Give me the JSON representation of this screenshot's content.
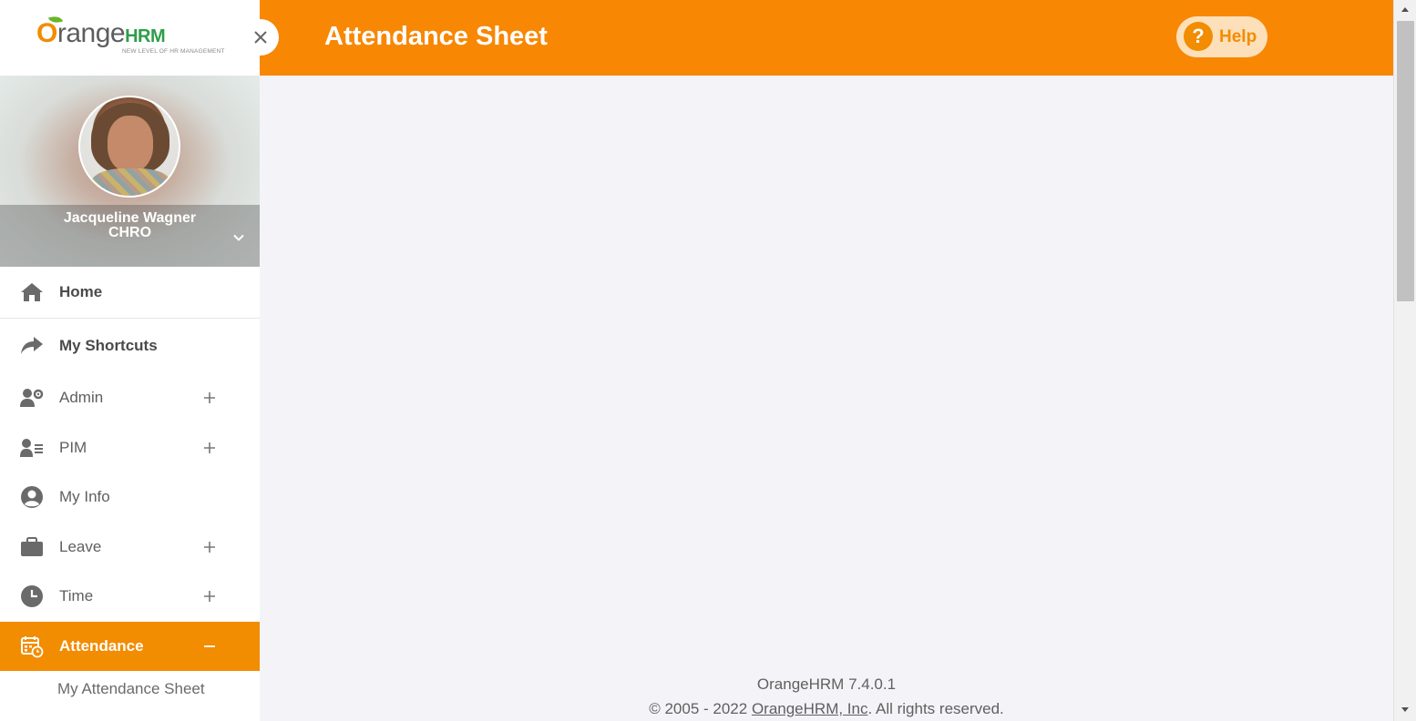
{
  "app": {
    "brand": "OrangeHRM",
    "tagline": "NEW LEVEL OF HR MANAGEMENT"
  },
  "profile": {
    "name": "Jacqueline Wagner",
    "role": "CHRO"
  },
  "menu": {
    "home": "Home",
    "shortcuts": "My Shortcuts",
    "items": [
      {
        "label": "Admin",
        "icon": "user-gear-icon",
        "expandable": true
      },
      {
        "label": "PIM",
        "icon": "user-list-icon",
        "expandable": true
      },
      {
        "label": "My Info",
        "icon": "user-circle-icon",
        "expandable": false
      },
      {
        "label": "Leave",
        "icon": "briefcase-icon",
        "expandable": true
      },
      {
        "label": "Time",
        "icon": "clock-icon",
        "expandable": true
      },
      {
        "label": "Attendance",
        "icon": "calendar-clock-icon",
        "expanded": true
      }
    ],
    "submenu": [
      "My Attendance Sheet"
    ]
  },
  "header": {
    "title": "Attendance Sheet",
    "help_label": "Help",
    "help_icon": "?"
  },
  "footer": {
    "version": "OrangeHRM 7.4.0.1",
    "copyright_prefix": "© 2005 - 2022 ",
    "company_link": "OrangeHRM, Inc",
    "copyright_suffix": ". All rights reserved."
  },
  "colors": {
    "accent": "#f88703",
    "active_menu": "#f28c00",
    "help_bg": "#fde0b9",
    "content_bg": "#f4f4f8"
  }
}
